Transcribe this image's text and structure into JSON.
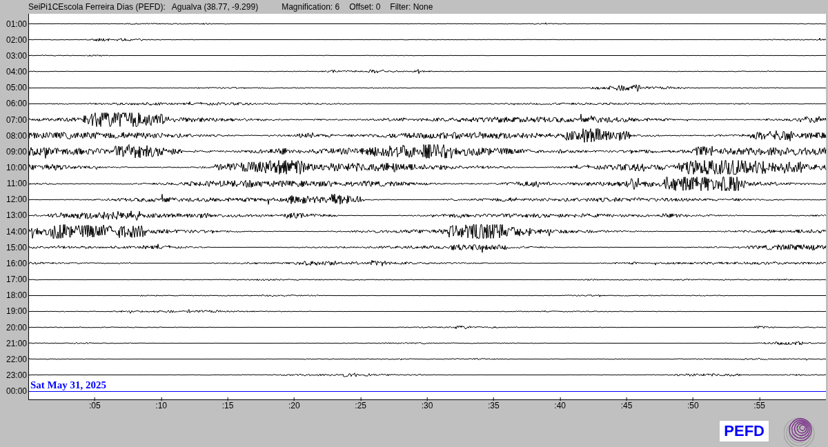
{
  "header": {
    "station": "SeiPi1CEscola Ferreira Dias (PEFD):",
    "location": "Agualva (38.77, -9.299)",
    "magnification": "Magnification: 6",
    "offset": "Offset: 0",
    "filter": "Filter: None"
  },
  "rows": [
    {
      "time": "01:00",
      "kind": "trace"
    },
    {
      "time": "02:00",
      "kind": "trace"
    },
    {
      "time": "03:00",
      "kind": "trace"
    },
    {
      "time": "04:00",
      "kind": "trace"
    },
    {
      "time": "05:00",
      "kind": "trace"
    },
    {
      "time": "06:00",
      "kind": "trace"
    },
    {
      "time": "07:00",
      "kind": "trace"
    },
    {
      "time": "08:00",
      "kind": "trace"
    },
    {
      "time": "09:00",
      "kind": "trace"
    },
    {
      "time": "10:00",
      "kind": "trace"
    },
    {
      "time": "11:00",
      "kind": "trace"
    },
    {
      "time": "12:00",
      "kind": "trace"
    },
    {
      "time": "13:00",
      "kind": "trace"
    },
    {
      "time": "14:00",
      "kind": "trace"
    },
    {
      "time": "15:00",
      "kind": "trace"
    },
    {
      "time": "16:00",
      "kind": "trace"
    },
    {
      "time": "17:00",
      "kind": "trace"
    },
    {
      "time": "18:00",
      "kind": "trace"
    },
    {
      "time": "19:00",
      "kind": "trace"
    },
    {
      "time": "20:00",
      "kind": "trace"
    },
    {
      "time": "21:00",
      "kind": "trace"
    },
    {
      "time": "22:00",
      "kind": "trace"
    },
    {
      "time": "23:00",
      "kind": "trace"
    },
    {
      "time": "00:00",
      "kind": "current"
    }
  ],
  "date": "Sat May 31, 2025",
  "x_ticks": [
    ":05",
    ":10",
    ":15",
    ":20",
    ":25",
    ":30",
    ":35",
    ":40",
    ":45",
    ":50",
    ":55"
  ],
  "badge": "PEFD"
}
